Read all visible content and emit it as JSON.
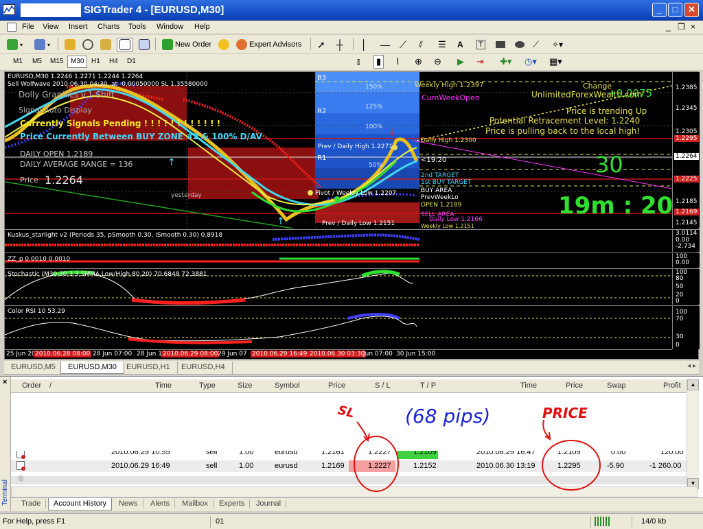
{
  "window": {
    "title": "SIGTrader 4 - [EURUSD,M30]",
    "min_label": "_",
    "max_label": "□",
    "close_label": "✕"
  },
  "menu": {
    "items": [
      "File",
      "View",
      "Insert",
      "Charts",
      "Tools",
      "Window",
      "Help"
    ],
    "mdi_min": "_",
    "mdi_restore": "❐",
    "mdi_close": "×"
  },
  "toolbar": {
    "new_order": "New Order",
    "expert_advisors": "Expert Advisors"
  },
  "timeframes": [
    "M1",
    "M5",
    "M15",
    "M30",
    "H1",
    "H4",
    "D1"
  ],
  "timeframe_selected": "M30",
  "chart": {
    "symbol_header": "EURUSD,M30  1.2246 1.2271 1.2244 1.2264",
    "wolfwave": "Sell Wolfwave 2010.06.30 04:30, at -0.00050000 SL 1.35580000",
    "dolly_label": "Dolly Graphics v.1   Shift",
    "signal_display": "Signal Auto Display",
    "signals_pending": "Currently Signals Pending ! ! ! ! ! ! ! ! ! ! ! !",
    "price_between": "Price Currently Between BUY ZONE #2 & 100% D/AV",
    "daily_open": "DAILY OPEN 1.2189",
    "daily_average_range": "DAILY AVERAGE RANGE = 136",
    "price_label": "Price",
    "price_value": "1.2264",
    "yesterday": "yesterday",
    "b3": "B3",
    "r2": "R2",
    "r1": "R1",
    "pct_150": "150%",
    "pct_125": "125%",
    "pct_100": "100%",
    "pct_50": "50%",
    "weekly_high": "Weekly High 1.2397",
    "cum_week_open": "CumWeekOpen",
    "daily_high": "Daily High 1.2300",
    "prev_daily_high": "Prev / Daily High 1.2271",
    "countdown_small": "<19:20",
    "second_target": "2nd TARGET",
    "first_buy_target": "1st BUY TARGET",
    "buy_area": "BUY AREA",
    "prev_week_lo": "PrevWeekLo",
    "pivot": "Pivot / Weekly Low 1.2207",
    "open": "OPEN 1.2189",
    "sell_area": "SELL AREA",
    "daily_low": "Daily Low 1.2166",
    "prev_daily_low": "Prev / Daily Low 1.2151",
    "weekly_low": "Weekly Low 1.2151",
    "change_label": "Change",
    "brand": "UnlimitedForexWealth.com",
    "change_value": "+0.0075",
    "trend": "Price is trending Up",
    "retracement": "Potential Retracement Level: 1.2240",
    "pulling_back": "Price is pulling back to the local high!",
    "big_number": "30",
    "countdown": "19m : 20",
    "price_scale": {
      "p1": "1.2385",
      "p2": "1.2345",
      "p3": "1.2305",
      "p4": "1.2295",
      "p5": "1.2264",
      "p6": "1.2225",
      "p7": "1.2185",
      "p8": "1.2169",
      "p9": "1.2145"
    }
  },
  "indicators": {
    "kuskus": "Kuskus_starlight v2  (Periods 35, pSmooth 0.30, iSmooth 0.30)  0.8918",
    "kuskus_scale": [
      "3.0114",
      "0.00",
      "-2.734"
    ],
    "zz": "ZZ_p 0.0010 0.0010",
    "zz_scale": [
      "100",
      "0.00"
    ],
    "stochastic": "Stochastic (M30,30,3,3,SMMA,Low/High,80,20) 70.6848 72.3881",
    "stoch_scale": [
      "100",
      "80",
      "50",
      "20",
      "0"
    ],
    "rsi": "Color RSI 10 53.29",
    "rsi_scale": [
      "100",
      "70",
      "30",
      "0"
    ]
  },
  "time_axis": [
    {
      "text": "25 Jun 20",
      "red": false
    },
    {
      "text": "2010.06.28 08:00",
      "red": true
    },
    {
      "text": "28 Jun 07:00",
      "red": false
    },
    {
      "text": "28 Jun 1",
      "red": false
    },
    {
      "text": "2010.06.29 08:00",
      "red": true
    },
    {
      "text": "29 Jun 07",
      "red": false
    },
    {
      "text": "2010.06.29 16:49",
      "red": true
    },
    {
      "text": "2010.06.30 03:30",
      "red": true
    },
    {
      "text": "Jun 07:00",
      "red": false
    },
    {
      "text": "30 Jun 15:00",
      "red": false
    }
  ],
  "chart_tabs": [
    "EURUSD,M5",
    "EURUSD,M30",
    "EURUSD,H1",
    "EURUSD,H4"
  ],
  "chart_tab_active": "EURUSD,M30",
  "chart_tab_arrows": "◂ ▸",
  "terminal": {
    "close": "×",
    "side_label": "Terminal",
    "columns": [
      "Order",
      "/",
      "Time",
      "Type",
      "Size",
      "Symbol",
      "Price",
      "S / L",
      "T / P",
      "Time",
      "Price",
      "Swap",
      "Profit"
    ],
    "rows": [
      {
        "open_time": "2010.06.29 10:55",
        "type": "sell",
        "size": "1.00",
        "symbol": "eurusd",
        "price": "1.2161",
        "sl": "1.2227",
        "tp": "1.2109",
        "close_time": "2010.06.29 16:47",
        "close_price": "1.2109",
        "swap": "0.00",
        "profit": "120.00"
      },
      {
        "open_time": "2010.06.29 16:49",
        "type": "sell",
        "size": "1.00",
        "symbol": "eurusd",
        "price": "1.2169",
        "sl": "1.2227",
        "tp": "1.2152",
        "close_time": "2010.06.30 13:19",
        "close_price": "1.2295",
        "swap": "-5.90",
        "profit": "-1 260.00"
      }
    ],
    "tabs": [
      "Trade",
      "Account History",
      "News",
      "Alerts",
      "Mailbox",
      "Experts",
      "Journal"
    ],
    "active_tab": "Account History"
  },
  "status": {
    "help": "For Help, press F1",
    "profile": "01",
    "traffic": "14/0 kb"
  },
  "annotations": {
    "sl": "SL",
    "pips": "(68 pips)",
    "price": "PRICE"
  },
  "colors": {
    "title_bar": "#1752c9",
    "chart_bg": "#000000",
    "buy_zone_blue": "#2a6ef0",
    "sell_zone_red": "#9b1010",
    "annotation_red": "#e01010",
    "annotation_blue": "#1a24d8",
    "profit_green": "#3fd13f"
  }
}
